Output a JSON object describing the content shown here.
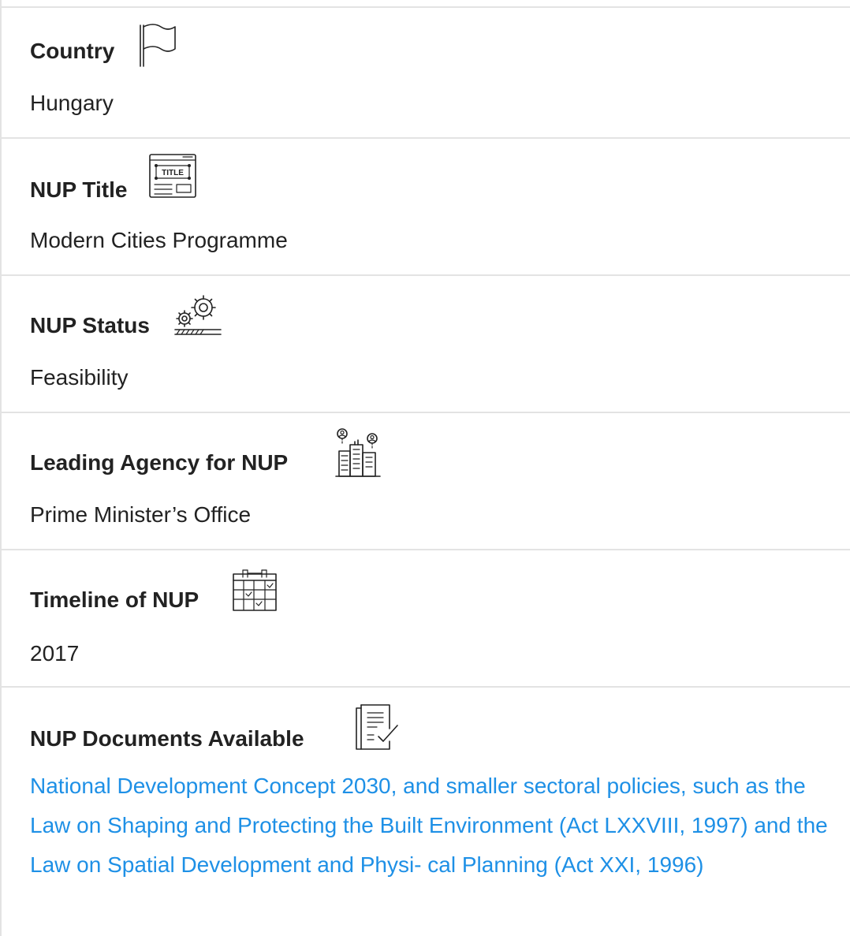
{
  "fields": {
    "country": {
      "label": "Country",
      "value": "Hungary",
      "icon": "flag-icon"
    },
    "title": {
      "label": "NUP Title",
      "value": "Modern Cities Programme",
      "icon": "title-icon",
      "icon_text": "TITLE"
    },
    "status": {
      "label": "NUP Status",
      "value": "Feasibility",
      "icon": "gears-progress-icon"
    },
    "agency": {
      "label": "Leading Agency for NUP",
      "value": "Prime Minister’s Office",
      "icon": "buildings-people-icon"
    },
    "timeline": {
      "label": "Timeline of NUP",
      "value": "2017",
      "icon": "calendar-icon"
    },
    "documents": {
      "label": "NUP Documents Available",
      "value": "National Development Concept 2030, and smaller sectoral policies, such as the Law on Shaping and Protecting the Built Environment (Act LXXVIII, 1997) and the Law on Spatial Development and Physi- cal Planning (Act XXI, 1996)",
      "icon": "document-check-icon"
    }
  },
  "colors": {
    "text": "#222222",
    "link": "#1e90e6",
    "divider": "#e3e3e3"
  }
}
